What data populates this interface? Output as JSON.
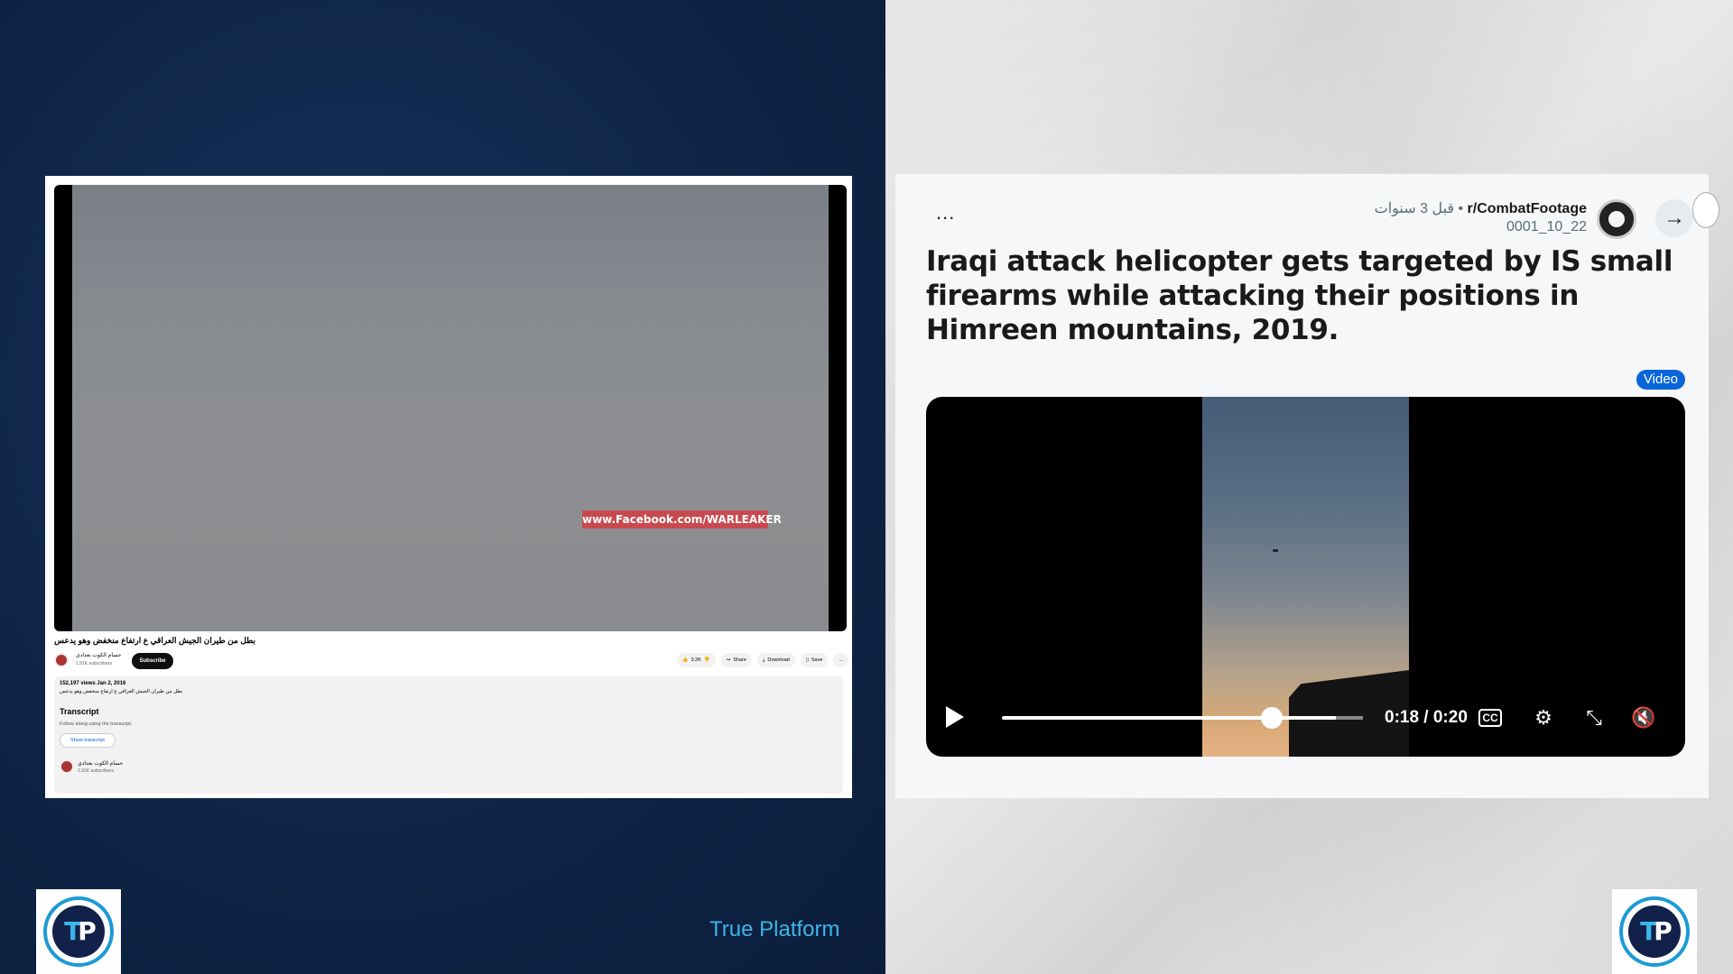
{
  "branding": {
    "label": "True Platform",
    "logo_text_t": "T",
    "logo_text_p": "P"
  },
  "youtube": {
    "watermark": "www.Facebook.com/WARLEAKER",
    "title": "بطل من طيران الجيش العراقي ع ارتفاع منخفض وهو يدعس",
    "channel_name": "حسام الكوت بغدادي",
    "subscribers": "1.91K subscribers",
    "subscribe_label": "Subscribe",
    "like_count": "3.2K",
    "share_label": "Share",
    "download_label": "Download",
    "save_label": "Save",
    "more_label": "...",
    "views_date": "152,197 views  Jan 2, 2016",
    "description": "بطل من طيران الجيش العراقي ع ارتفاع منخفض وهو يدعس",
    "transcript_heading": "Transcript",
    "transcript_sub": "Follow along using the transcript.",
    "transcript_button": "Show transcript",
    "bottom_channel_name": "حسام الكوت بغدادي",
    "bottom_subscribers": "1.91K subscribers"
  },
  "reddit": {
    "more_label": "...",
    "subreddit": "r/CombatFootage",
    "time_ago": "قبل 3 سنوات",
    "separator": " • ",
    "username": "0001_10_22",
    "title": "Iraqi attack helicopter gets targeted by IS small firearms while attacking their positions in Himreen mountains, 2019.",
    "badge": "Video",
    "time_display": "0:18 / 0:20",
    "cc_label": "CC",
    "progress": 0.9
  }
}
